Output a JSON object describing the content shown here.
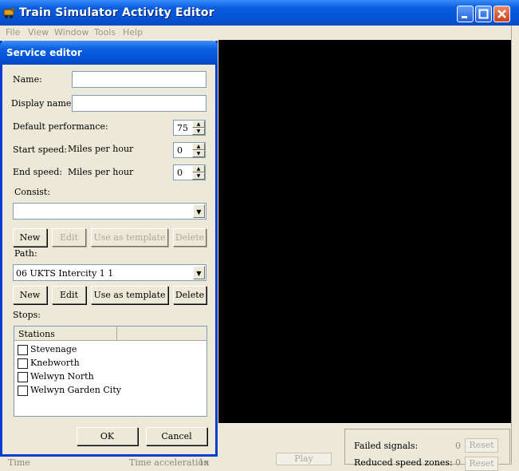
{
  "main_window": {
    "title": "Train Simulator Activity Editor",
    "menu": [
      "File",
      "View",
      "Window",
      "Tools",
      "Help"
    ]
  },
  "status_panel": {
    "failed_signals_label": "Failed signals:",
    "failed_signals_value": "0",
    "reduced_speed_label": "Reduced speed zones:",
    "reduced_speed_value": "0",
    "reset_label": "Reset",
    "play_label": "Play",
    "time_label": "Time",
    "time_acceleration_label": "Time acceleration",
    "time_acceleration_value": "1x"
  },
  "dialog": {
    "title": "Service editor",
    "name_label": "Name:",
    "name_value": "",
    "display_name_label": "Display name:",
    "display_name_value": "",
    "default_performance_label": "Default performance:",
    "default_performance_value": "75",
    "start_speed_label": "Start speed:",
    "start_speed_unit": "Miles per hour",
    "start_speed_value": "0",
    "end_speed_label": "End speed:",
    "end_speed_unit": "Miles per hour",
    "end_speed_value": "0",
    "consist_label": "Consist:",
    "consist_value": "",
    "path_label": "Path:",
    "path_value": "06 UKTS Intercity 1 1",
    "buttons": {
      "new": "New",
      "edit": "Edit",
      "use_as_template": "Use as template",
      "delete": "Delete",
      "ok": "OK",
      "cancel": "Cancel"
    },
    "stops_label": "Stops:",
    "stations_header": "Stations",
    "stations": [
      {
        "name": "Stevenage",
        "checked": false
      },
      {
        "name": "Knebworth",
        "checked": false
      },
      {
        "name": "Welwyn North",
        "checked": false
      },
      {
        "name": "Welwyn Garden City",
        "checked": false
      }
    ]
  }
}
